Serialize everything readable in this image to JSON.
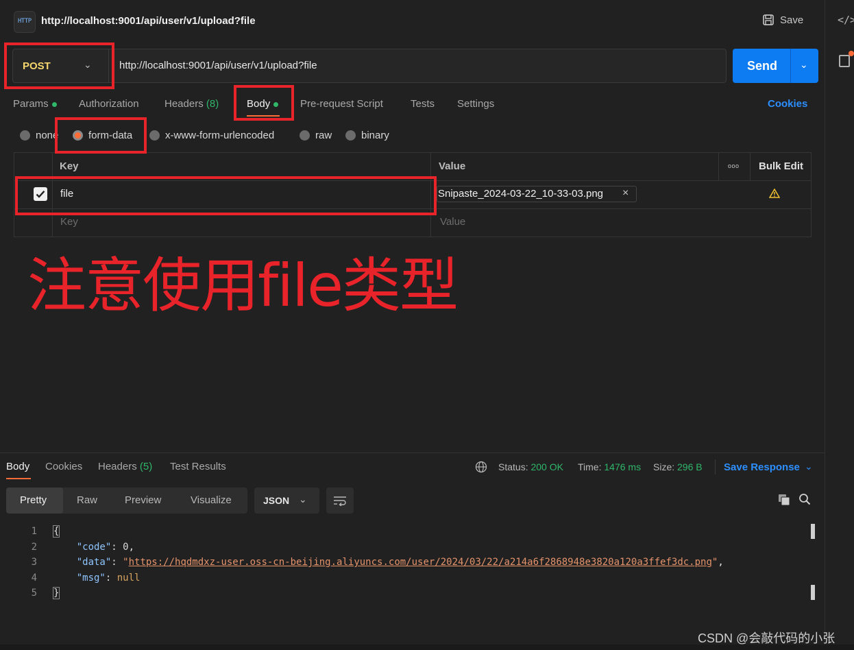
{
  "header": {
    "icon_label": "HTTP",
    "title": "http://localhost:9001/api/user/v1/upload?file",
    "save_label": "Save",
    "code_icon": "</>"
  },
  "request": {
    "method": "POST",
    "url": "http://localhost:9001/api/user/v1/upload?file",
    "send_label": "Send"
  },
  "request_tabs": {
    "params": "Params",
    "authorization": "Authorization",
    "headers": "Headers",
    "headers_count": "(8)",
    "body": "Body",
    "prerequest": "Pre-request Script",
    "tests": "Tests",
    "settings": "Settings",
    "cookies": "Cookies"
  },
  "body_modes": {
    "none": "none",
    "form_data": "form-data",
    "urlencoded": "x-www-form-urlencoded",
    "raw": "raw",
    "binary": "binary",
    "selected": "form-data"
  },
  "form_table": {
    "key_header": "Key",
    "value_header": "Value",
    "more_icon": "ooo",
    "bulk_edit": "Bulk Edit",
    "rows": [
      {
        "checked": true,
        "key": "file",
        "value": "Snipaste_2024-03-22_10-33-03.png"
      }
    ],
    "key_placeholder": "Key",
    "value_placeholder": "Value"
  },
  "annotation": "注意使用file类型",
  "response_tabs": {
    "body": "Body",
    "cookies": "Cookies",
    "headers": "Headers",
    "headers_count": "(5)",
    "test_results": "Test Results"
  },
  "response_status": {
    "status_label": "Status:",
    "status_value": "200 OK",
    "time_label": "Time:",
    "time_value": "1476 ms",
    "size_label": "Size:",
    "size_value": "296 B",
    "save_response": "Save Response"
  },
  "view_modes": {
    "pretty": "Pretty",
    "raw": "Raw",
    "preview": "Preview",
    "visualize": "Visualize",
    "format": "JSON"
  },
  "code": {
    "line_numbers": [
      "1",
      "2",
      "3",
      "4",
      "5"
    ],
    "open_brace": "{",
    "close_brace": "}",
    "code_key": "\"code\"",
    "code_value": "0",
    "data_key": "\"data\"",
    "data_value": "https://hqdmdxz-user.oss-cn-beijing.aliyuncs.com/user/2024/03/22/a214a6f2868948e3820a120a3ffef3dc.png",
    "msg_key": "\"msg\"",
    "msg_value": "null"
  },
  "watermark": "CSDN @会敲代码的小张",
  "colors": {
    "accent_orange": "#ff6c37",
    "send_blue": "#0d7bf2",
    "link_blue": "#2d8fff",
    "status_green": "#2fb86a",
    "annotation_red": "#e8232a"
  }
}
